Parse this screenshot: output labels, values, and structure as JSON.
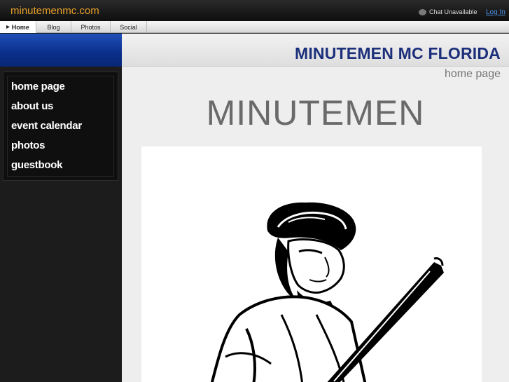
{
  "topbar": {
    "site_name": "minutemenmc.com",
    "chat_status": "Chat Unavailable",
    "login_label": "Log In"
  },
  "tabs": [
    {
      "label": "Home",
      "active": true
    },
    {
      "label": "Blog",
      "active": false
    },
    {
      "label": "Photos",
      "active": false
    },
    {
      "label": "Social",
      "active": false
    }
  ],
  "header": {
    "site_title": "MINUTEMEN MC FLORIDA"
  },
  "content": {
    "page_label": "home page",
    "heading": "MINUTEMEN"
  },
  "sidebar": {
    "items": [
      {
        "label": "home page"
      },
      {
        "label": "about us"
      },
      {
        "label": "event calendar"
      },
      {
        "label": "photos"
      },
      {
        "label": "guestbook"
      }
    ]
  },
  "colors": {
    "brand_orange": "#e8a12a",
    "header_blue": "#1c2f7a",
    "link_blue": "#4a90e2"
  }
}
